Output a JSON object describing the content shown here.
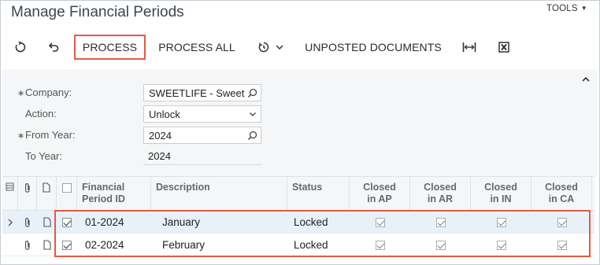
{
  "page": {
    "title": "Manage Financial Periods",
    "tools_label": "TOOLS"
  },
  "toolbar": {
    "refresh_icon": "refresh-icon",
    "undo_icon": "undo-icon",
    "process_label": "PROCESS",
    "process_all_label": "PROCESS ALL",
    "schedule_icon": "schedule-icon",
    "unposted_label": "UNPOSTED DOCUMENTS",
    "fit_icon": "fit-columns-icon",
    "excel_icon": "export-excel-icon"
  },
  "filter": {
    "company_label": "Company:",
    "company_value": "SWEETLIFE - Sweet",
    "action_label": "Action:",
    "action_value": "Unlock",
    "from_year_label": "From Year:",
    "from_year_value": "2024",
    "to_year_label": "To Year:",
    "to_year_value": "2024"
  },
  "grid": {
    "columns": {
      "period_id": [
        "Financial",
        "Period ID"
      ],
      "description": "Description",
      "status": "Status",
      "closed_ap": [
        "Closed",
        "in AP"
      ],
      "closed_ar": [
        "Closed",
        "in AR"
      ],
      "closed_in": [
        "Closed",
        "in IN"
      ],
      "closed_ca": [
        "Closed",
        "in CA"
      ]
    },
    "rows": [
      {
        "selected": true,
        "period_id": "01-2024",
        "description": "January",
        "status": "Locked",
        "ap": true,
        "ar": true,
        "in": true,
        "ca": true
      },
      {
        "selected": true,
        "period_id": "02-2024",
        "description": "February",
        "status": "Locked",
        "ap": true,
        "ar": true,
        "in": true,
        "ca": true
      }
    ]
  },
  "colors": {
    "highlight": "#e25b45",
    "selected_row": "#e8f1fa",
    "panel": "#f5f6f7"
  }
}
